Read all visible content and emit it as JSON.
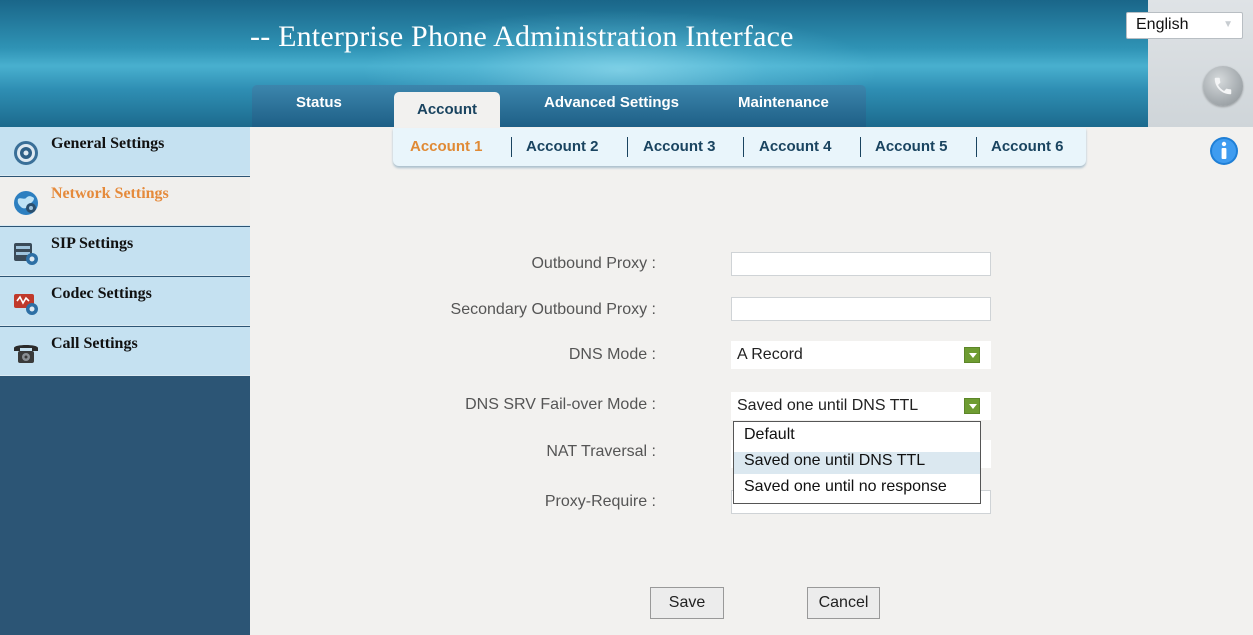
{
  "app": {
    "title": "-- Enterprise Phone Administration Interface"
  },
  "language": {
    "selected": "English"
  },
  "top_tabs": [
    "Status",
    "Account",
    "Advanced Settings",
    "Maintenance"
  ],
  "sub_tabs": [
    "Account 1",
    "Account 2",
    "Account 3",
    "Account 4",
    "Account 5",
    "Account 6"
  ],
  "sidebar": {
    "items": [
      {
        "label": "General Settings",
        "icon": "gear-icon"
      },
      {
        "label": "Network Settings",
        "icon": "network-globe-icon"
      },
      {
        "label": "SIP Settings",
        "icon": "sip-server-icon"
      },
      {
        "label": "Codec Settings",
        "icon": "codec-icon"
      },
      {
        "label": "Call Settings",
        "icon": "telephone-icon"
      }
    ]
  },
  "form": {
    "outbound_proxy": {
      "label": "Outbound Proxy :",
      "value": ""
    },
    "secondary_outbound_proxy": {
      "label": "Secondary Outbound Proxy :",
      "value": ""
    },
    "dns_mode": {
      "label": "DNS Mode :",
      "value": "A Record"
    },
    "dns_srv_failover": {
      "label": "DNS SRV Fail-over Mode :",
      "value": "Saved one until DNS TTL",
      "options": [
        "Default",
        "Saved one until DNS TTL",
        "Saved one until no response"
      ]
    },
    "nat_traversal": {
      "label": "NAT Traversal :"
    },
    "proxy_require": {
      "label": "Proxy-Require :",
      "value": ""
    }
  },
  "buttons": {
    "save": "Save",
    "cancel": "Cancel"
  },
  "colors": {
    "header_blue": "#2f93b5",
    "sidebar_dark": "#2c5575",
    "sidebar_item": "#c5e1f1",
    "active_orange": "#e58a3b",
    "select_green": "#6e9c32"
  }
}
